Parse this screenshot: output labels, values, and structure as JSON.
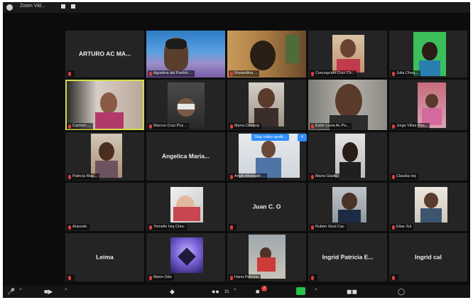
{
  "app": {
    "title": "Zoom Vid...",
    "accent": "#d6dc4c",
    "tile_bg": "#242424",
    "muted_color": "#e03b3b"
  },
  "tiles": [
    {
      "id": "t00",
      "big_name": "ARTURO AC MA...",
      "label": "",
      "video": false
    },
    {
      "id": "t01",
      "big_name": "",
      "label": "Agustina del Pueblo ...",
      "video": true
    },
    {
      "id": "t02",
      "big_name": "",
      "label": "Rosandina ...",
      "video": true
    },
    {
      "id": "t03",
      "big_name": "",
      "label": "Concepcion Cruz Ch...",
      "video": true
    },
    {
      "id": "t04",
      "big_name": "",
      "label": "Julia Choq...",
      "video": true
    },
    {
      "id": "t10",
      "big_name": "",
      "label": "Carmen ...",
      "video": true
    },
    {
      "id": "t11",
      "big_name": "",
      "label": "Marcos Cruz Poz...",
      "video": true
    },
    {
      "id": "t12",
      "big_name": "",
      "label": "Maria Chaquiy",
      "video": true
    },
    {
      "id": "t13",
      "big_name": "",
      "label": "Ester Lucia Ac Pe...",
      "video": true
    },
    {
      "id": "t14",
      "big_name": "",
      "label": "Jorge Villas Ros...",
      "video": true
    },
    {
      "id": "t20",
      "big_name": "",
      "label": "Patricia Mac...",
      "video": true
    },
    {
      "id": "t21",
      "big_name": "Angelica Maria...",
      "label": "",
      "video": false
    },
    {
      "id": "t22",
      "big_name": "",
      "label": "Angie Alvarado ...",
      "video": true
    },
    {
      "id": "t23",
      "big_name": "",
      "label": "Maria Gladis",
      "video": true
    },
    {
      "id": "t24",
      "big_name": "",
      "label": "Claudia Ixq",
      "video": false
    },
    {
      "id": "t30",
      "big_name": "",
      "label": "Aracede",
      "video": false
    },
    {
      "id": "t31",
      "big_name": "",
      "label": "Yomelie Ixiq Choc",
      "video": true
    },
    {
      "id": "t32",
      "big_name": "Juan C. O",
      "label": "",
      "video": false
    },
    {
      "id": "t33",
      "big_name": "",
      "label": "Rubén Xicol Cac",
      "video": true
    },
    {
      "id": "t34",
      "big_name": "",
      "label": "Elias Xul",
      "video": true
    },
    {
      "id": "t40",
      "big_name": "Leima",
      "label": "",
      "video": false
    },
    {
      "id": "t41",
      "big_name": "",
      "label": "Mario Odo",
      "video": true
    },
    {
      "id": "t42",
      "big_name": "",
      "label": "Hana Petrona",
      "video": true
    },
    {
      "id": "t43",
      "big_name": "Ingrid Patricia E...",
      "label": "",
      "video": false
    },
    {
      "id": "t44",
      "big_name": "Ingrid cal",
      "label": "",
      "video": false
    }
  ],
  "tooltip": {
    "text": "Stop video spotlt...",
    "close": "x"
  },
  "toolbar": {
    "mic_icon": "microphone-icon",
    "video_icon": "video-camera-icon",
    "security_icon": "shield-icon",
    "participants_icon": "participants-icon",
    "participants_count": "31",
    "chat_icon": "chat-icon",
    "chat_badge": "7",
    "share_icon": "share-screen-icon",
    "record_icon": "record-icon",
    "reactions_icon": "reactions-icon"
  }
}
